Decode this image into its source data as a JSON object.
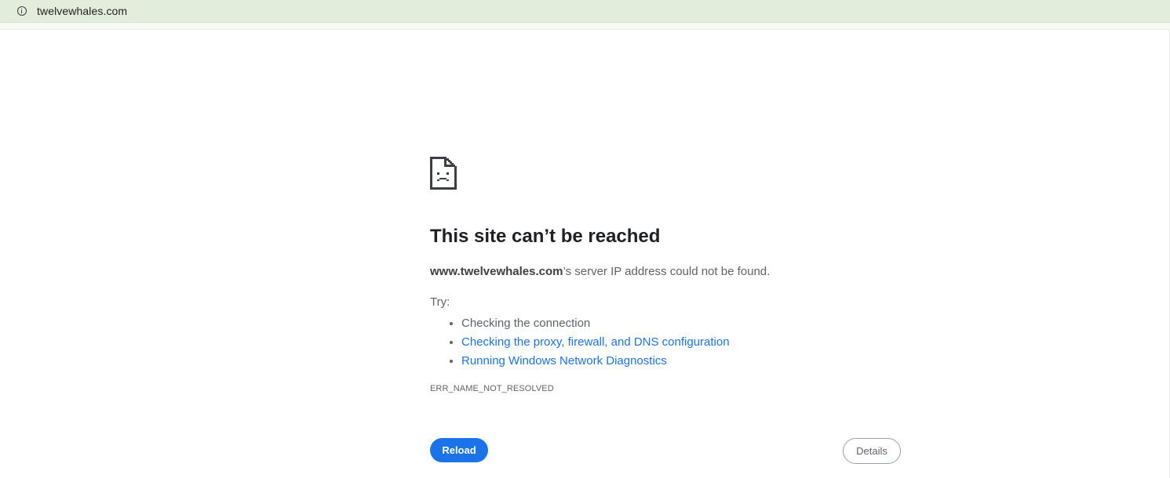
{
  "address_bar": {
    "url": "twelvewhales.com",
    "site_info_icon": "info-icon"
  },
  "error_page": {
    "icon": "sad-document-icon",
    "title": "This site can’t be reached",
    "host": "www.twelvewhales.com",
    "description_suffix": "’s server IP address could not be found.",
    "try_label": "Try:",
    "suggestions": [
      {
        "text": "Checking the connection",
        "is_link": false
      },
      {
        "text": "Checking the proxy, firewall, and DNS configuration",
        "is_link": true
      },
      {
        "text": "Running Windows Network Diagnostics",
        "is_link": true
      }
    ],
    "error_code": "ERR_NAME_NOT_RESOLVED",
    "reload_label": "Reload",
    "details_label": "Details"
  },
  "colors": {
    "address_bar_bg": "#e3eddc",
    "accent_blue": "#1a73e8",
    "text_dark": "#202124",
    "text_grey": "#5f6368"
  }
}
